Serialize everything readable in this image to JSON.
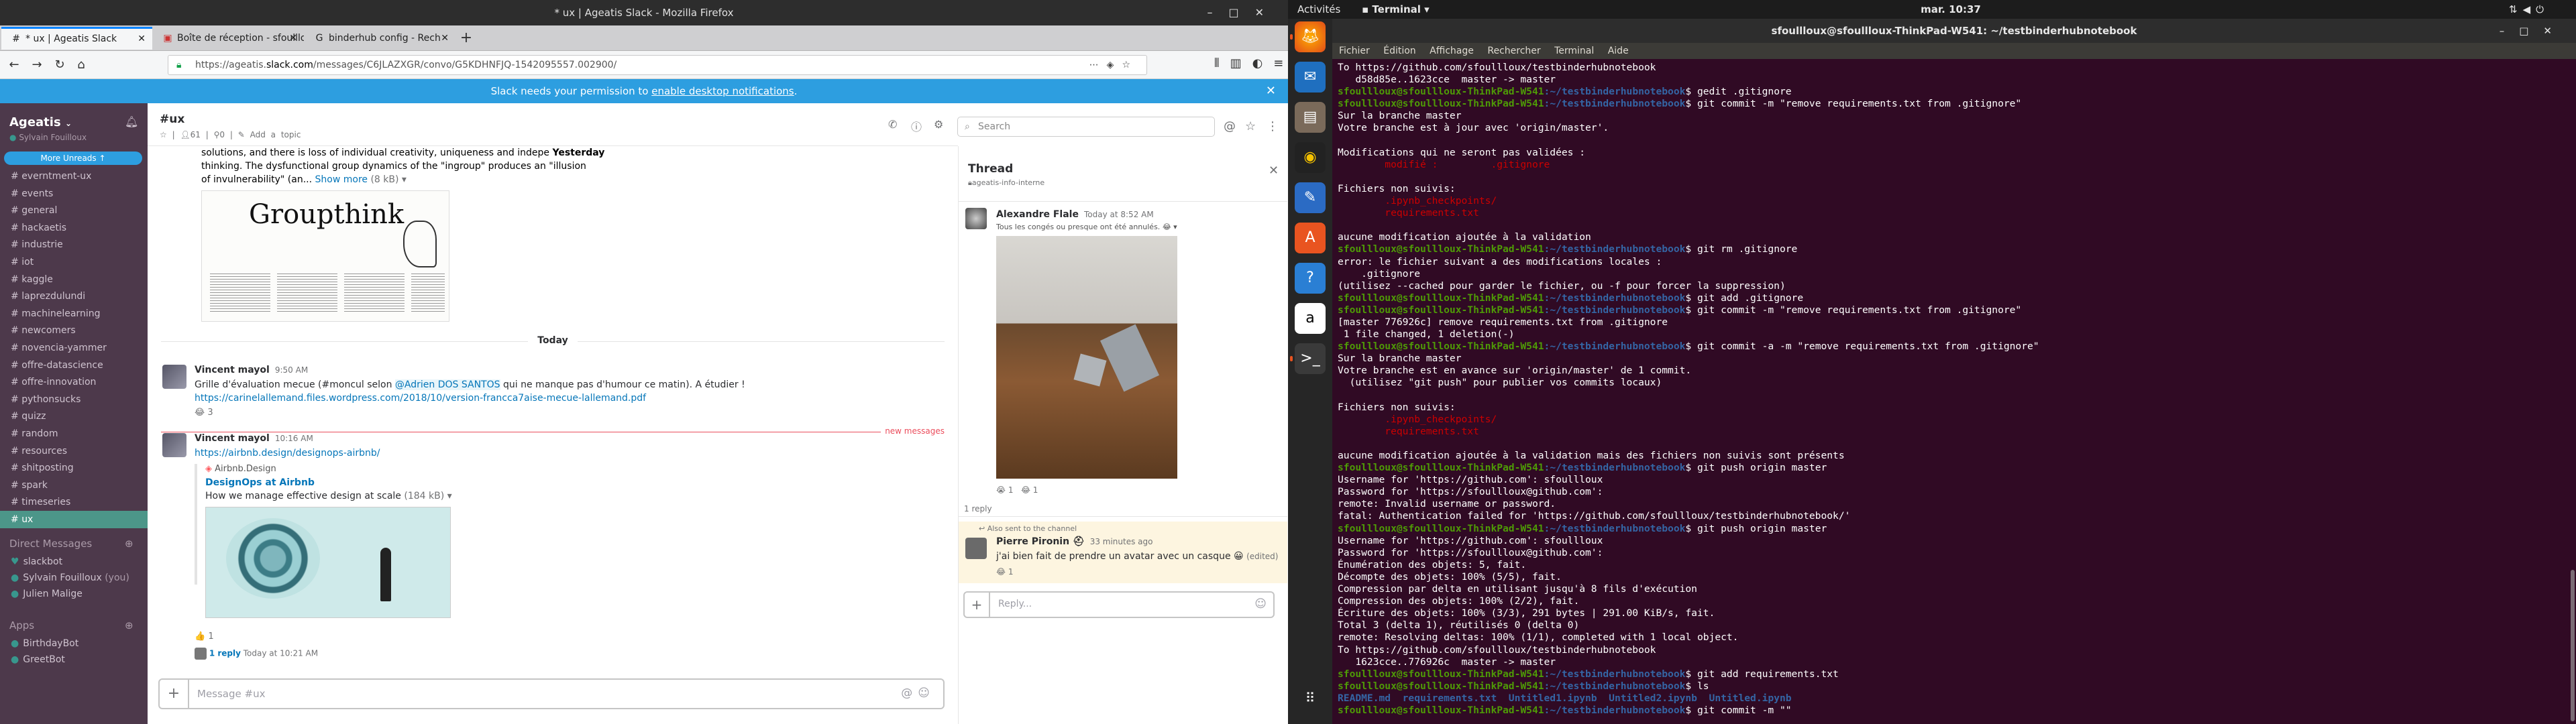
{
  "topbar": {
    "activities": "Activités",
    "app": "Terminal",
    "clock": "mar. 10:37"
  },
  "firefox": {
    "title": "* ux | Ageatis Slack - Mozilla Firefox",
    "tabs": [
      {
        "label": "* ux | Ageatis Slack"
      },
      {
        "label": "Boîte de réception - sfoullloux"
      },
      {
        "label": "binderhub config - Rech"
      }
    ],
    "url_prefix": "https://ageatis.",
    "url_host": "slack.com",
    "url_suffix": "/messages/C6JLAZXGR/convo/G5KDHNFJQ-1542095557.002900/",
    "banner_text": "Slack needs your permission to ",
    "banner_link": "enable desktop notifications",
    "banner_end": "."
  },
  "slack": {
    "team": "Ageatis",
    "user": "Sylvain Fouilloux",
    "more_unreads": "More Unreads",
    "channels": [
      "everntment-ux",
      "events",
      "general",
      "hackaetis",
      "industrie",
      "iot",
      "kaggle",
      "laprezdulundi",
      "machinelearning",
      "newcomers",
      "novencia-yammer",
      "offre-datascience",
      "offre-innovation",
      "pythonsucks",
      "quizz",
      "random",
      "resources",
      "shitposting",
      "spark",
      "timeseries",
      "ux"
    ],
    "active_channel": "ux",
    "dm_header": "Direct Messages",
    "dms": [
      {
        "name": "slackbot",
        "you": ""
      },
      {
        "name": "Sylvain Fouilloux",
        "you": "(you)"
      },
      {
        "name": "Julien Malige",
        "you": ""
      }
    ],
    "apps_header": "Apps",
    "apps": [
      {
        "name": "BirthdayBot"
      },
      {
        "name": "GreetBot"
      }
    ],
    "channel": {
      "name": "#ux",
      "members": "61",
      "pins": "0",
      "add_topic": "Add a topic"
    },
    "search_placeholder": "Search",
    "composer_placeholder": "Message #ux",
    "messages": {
      "prev_line1": "solutions, and there is loss of individual creativity, uniqueness and indepe",
      "prev_yesterday": "Yesterday",
      "prev_line2": "thinking. The dysfunctional group dynamics of the \"ingroup\" produces an \"illusion",
      "prev_line3": "of invulnerability\" (an...",
      "prev_show_more": "Show more",
      "prev_size": "(8 kB)",
      "image_title": "Groupthink",
      "today": "Today",
      "m1_author": "Vincent mayol",
      "m1_time": "9:50 AM",
      "m1_text_a": "Grille d'évaluation mecue (#moncul selon ",
      "m1_mention": "@Adrien DOS SANTOS",
      "m1_text_b": " qui ne manque pas d'humour ce matin). A étudier !",
      "m1_link": "https://carinelallemand.files.wordpress.com/2018/10/version-francca7aise-mecue-lallemand.pdf",
      "m1_reaction": "3",
      "new_messages": "new messages",
      "m2_author": "Vincent mayol",
      "m2_time": "10:16 AM",
      "m2_link": "https://airbnb.design/designops-airbnb/",
      "m2_site": "Airbnb.Design",
      "m2_title": "DesignOps at Airbnb",
      "m2_desc": "How we manage effective design at scale",
      "m2_size": "(184 kB)",
      "m2_reaction": "1",
      "m2_replies": "1 reply",
      "m2_reply_time": "Today at 10:21 AM"
    },
    "thread": {
      "title": "Thread",
      "sub": "ageatis-info-interne",
      "author1": "Alexandre Flale",
      "time1": "Today at 8:52 AM",
      "text1": "Tous les congés ou presque ont été annulés.",
      "reply_count": "1 reply",
      "also_sent": "Also sent to the channel",
      "author2": "Pierre Pironin",
      "time2": "33 minutes ago",
      "text2": "j'ai bien fait de prendre un avatar avec un casque",
      "edited": "(edited)",
      "reply_placeholder": "Reply..."
    }
  },
  "terminal": {
    "title": "sfoullloux@sfoullloux-ThinkPad-W541: ~/testbinderhubnotebook",
    "menu": [
      "Fichier",
      "Édition",
      "Affichage",
      "Rechercher",
      "Terminal",
      "Aide"
    ],
    "prompt_user": "sfoullloux@sfoullloux-ThinkPad-W541",
    "prompt_dir": ":~/testbinderhubnotebook",
    "lines": [
      {
        "t": "o",
        "s": "To https://github.com/sfoullloux/testbinderhubnotebook"
      },
      {
        "t": "o",
        "s": "   d58d85e..1623cce  master -> master"
      },
      {
        "t": "c",
        "s": "$ gedit .gitignore"
      },
      {
        "t": "c",
        "s": "$ git commit -m \"remove requirements.txt from .gitignore\""
      },
      {
        "t": "o",
        "s": "Sur la branche master"
      },
      {
        "t": "o",
        "s": "Votre branche est à jour avec 'origin/master'."
      },
      {
        "t": "o",
        "s": ""
      },
      {
        "t": "o",
        "s": "Modifications qui ne seront pas validées :"
      },
      {
        "t": "r",
        "s": "\tmodifié :         .gitignore"
      },
      {
        "t": "o",
        "s": ""
      },
      {
        "t": "o",
        "s": "Fichiers non suivis:"
      },
      {
        "t": "r",
        "s": "\t.ipynb_checkpoints/"
      },
      {
        "t": "r",
        "s": "\trequirements.txt"
      },
      {
        "t": "o",
        "s": ""
      },
      {
        "t": "o",
        "s": "aucune modification ajoutée à la validation"
      },
      {
        "t": "c",
        "s": "$ git rm .gitignore"
      },
      {
        "t": "o",
        "s": "error: le fichier suivant a des modifications locales :"
      },
      {
        "t": "o",
        "s": "    .gitignore"
      },
      {
        "t": "o",
        "s": "(utilisez --cached pour garder le fichier, ou -f pour forcer la suppression)"
      },
      {
        "t": "c",
        "s": "$ git add .gitignore"
      },
      {
        "t": "c",
        "s": "$ git commit -m \"remove requirements.txt from .gitignore\""
      },
      {
        "t": "o",
        "s": "[master 776926c] remove requirements.txt from .gitignore"
      },
      {
        "t": "o",
        "s": " 1 file changed, 1 deletion(-)"
      },
      {
        "t": "c",
        "s": "$ git commit -a -m \"remove requirements.txt from .gitignore\""
      },
      {
        "t": "o",
        "s": "Sur la branche master"
      },
      {
        "t": "o",
        "s": "Votre branche est en avance sur 'origin/master' de 1 commit."
      },
      {
        "t": "o",
        "s": "  (utilisez \"git push\" pour publier vos commits locaux)"
      },
      {
        "t": "o",
        "s": ""
      },
      {
        "t": "o",
        "s": "Fichiers non suivis:"
      },
      {
        "t": "r",
        "s": "\t.ipynb_checkpoints/"
      },
      {
        "t": "r",
        "s": "\trequirements.txt"
      },
      {
        "t": "o",
        "s": ""
      },
      {
        "t": "o",
        "s": "aucune modification ajoutée à la validation mais des fichiers non suivis sont présents"
      },
      {
        "t": "c",
        "s": "$ git push origin master"
      },
      {
        "t": "o",
        "s": "Username for 'https://github.com': sfoullloux"
      },
      {
        "t": "o",
        "s": "Password for 'https://sfoullloux@github.com':"
      },
      {
        "t": "o",
        "s": "remote: Invalid username or password."
      },
      {
        "t": "o",
        "s": "fatal: Authentication failed for 'https://github.com/sfoullloux/testbinderhubnotebook/'"
      },
      {
        "t": "c",
        "s": "$ git push origin master"
      },
      {
        "t": "o",
        "s": "Username for 'https://github.com': sfoullloux"
      },
      {
        "t": "o",
        "s": "Password for 'https://sfoullloux@github.com':"
      },
      {
        "t": "o",
        "s": "Énumération des objets: 5, fait."
      },
      {
        "t": "o",
        "s": "Décompte des objets: 100% (5/5), fait."
      },
      {
        "t": "o",
        "s": "Compression par delta en utilisant jusqu'à 8 fils d'exécution"
      },
      {
        "t": "o",
        "s": "Compression des objets: 100% (2/2), fait."
      },
      {
        "t": "o",
        "s": "Écriture des objets: 100% (3/3), 291 bytes | 291.00 KiB/s, fait."
      },
      {
        "t": "o",
        "s": "Total 3 (delta 1), réutilisés 0 (delta 0)"
      },
      {
        "t": "o",
        "s": "remote: Resolving deltas: 100% (1/1), completed with 1 local object."
      },
      {
        "t": "o",
        "s": "To https://github.com/sfoullloux/testbinderhubnotebook"
      },
      {
        "t": "o",
        "s": "   1623cce..776926c  master -> master"
      },
      {
        "t": "c",
        "s": "$ git add requirements.txt"
      },
      {
        "t": "c",
        "s": "$ ls"
      },
      {
        "t": "d",
        "s": "README.md  requirements.txt  Untitled1.ipynb  Untitled2.ipynb  Untitled.ipynb"
      },
      {
        "t": "c",
        "s": "$ git commit -m \"\""
      }
    ]
  }
}
